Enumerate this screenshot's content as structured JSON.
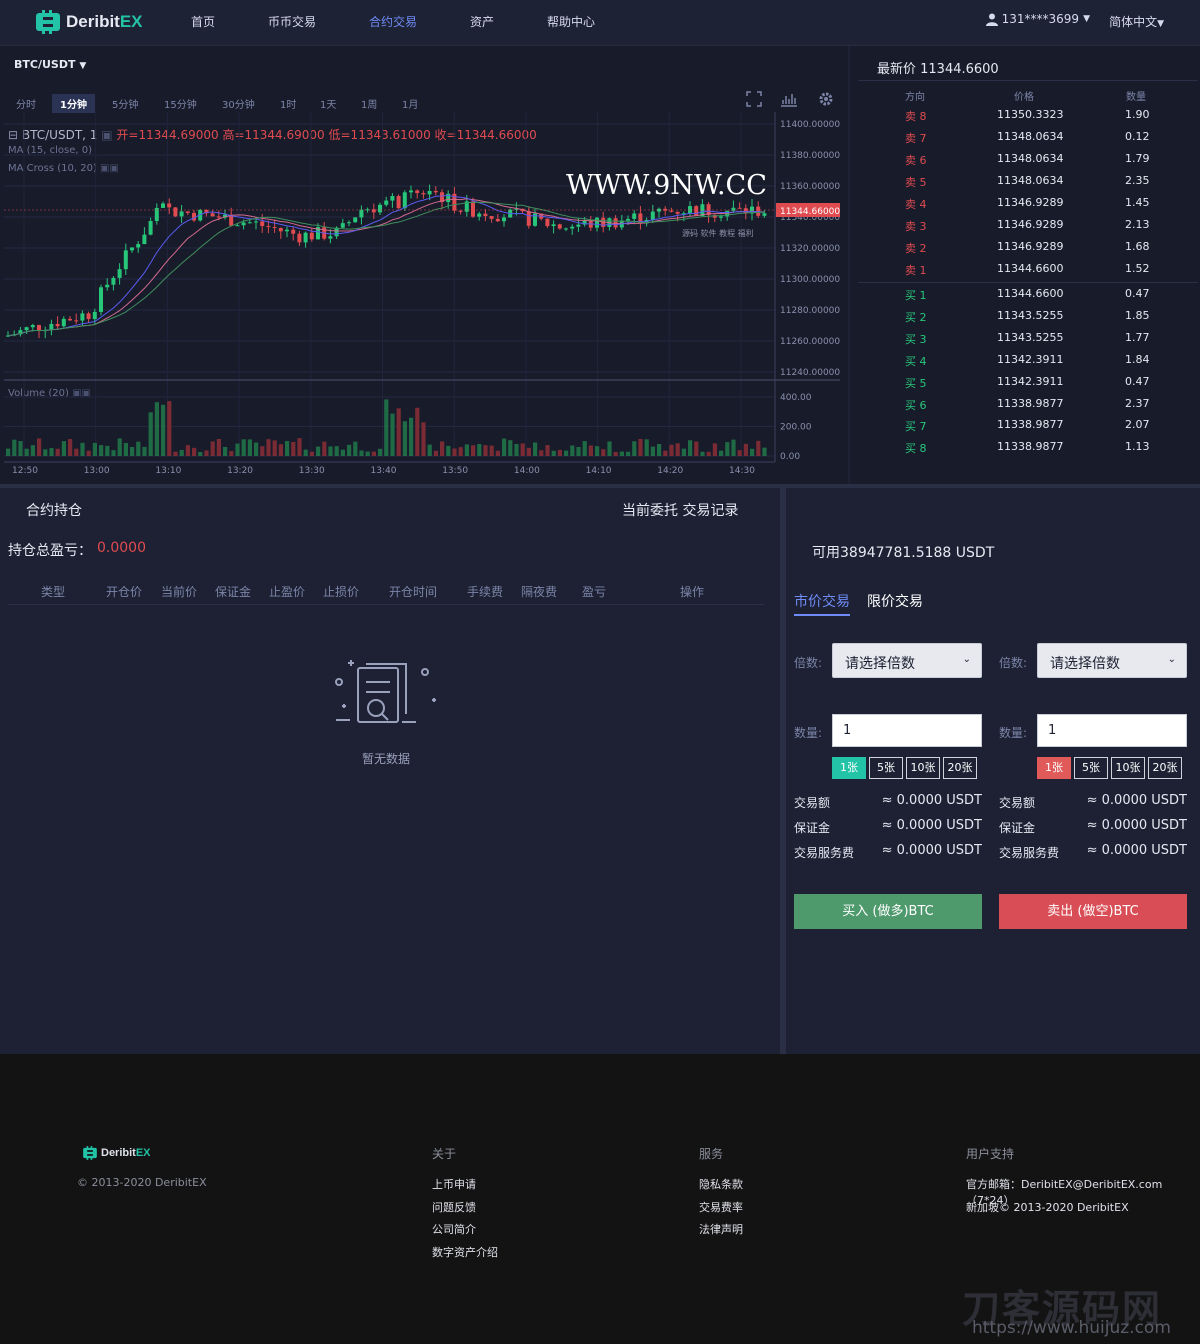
{
  "header": {
    "brand_a": "Deribit",
    "brand_b": "EX",
    "nav": [
      "首页",
      "币币交易",
      "合约交易",
      "资产",
      "帮助中心"
    ],
    "nav_active": 2,
    "user": "131****3699",
    "lang": "简体中文"
  },
  "chart": {
    "pair": "BTC/USDT",
    "timeframes": [
      "分时",
      "1分钟",
      "5分钟",
      "15分钟",
      "30分钟",
      "1时",
      "1天",
      "1周",
      "1月"
    ],
    "timeframe_active": 1,
    "hud_symbol": "BTC/USDT, 1",
    "hud_open": "开=11344.69000",
    "hud_high": "高=11344.69000",
    "hud_low": "低=11343.61000",
    "hud_close": "收=11344.66000",
    "ma_label": "MA (15, close, 0)",
    "macross_label": "MA Cross (10, 20)",
    "volume_label": "Volume (20)",
    "price_ticks": [
      "11400.00000",
      "11380.00000",
      "11360.00000",
      "11340.00000",
      "11320.00000",
      "11300.00000",
      "11280.00000",
      "11260.00000",
      "11240.00000"
    ],
    "last_price_tag": "11344.66000",
    "volume_ticks": [
      "400.00",
      "200.00",
      "0.00"
    ],
    "time_ticks": [
      "12:50",
      "13:00",
      "13:10",
      "13:20",
      "13:30",
      "13:40",
      "13:50",
      "14:00",
      "14:10",
      "14:20",
      "14:30"
    ],
    "watermark": "WWW.9NW.CC",
    "watermark_sub": "源码 软件 教程 福利"
  },
  "book": {
    "title": "最新价 11344.6600",
    "headers": [
      "方向",
      "价格",
      "数量"
    ],
    "asks": [
      {
        "side": "卖 8",
        "price": "11350.3323",
        "qty": "1.90"
      },
      {
        "side": "卖 7",
        "price": "11348.0634",
        "qty": "0.12"
      },
      {
        "side": "卖 6",
        "price": "11348.0634",
        "qty": "1.79"
      },
      {
        "side": "卖 5",
        "price": "11348.0634",
        "qty": "2.35"
      },
      {
        "side": "卖 4",
        "price": "11346.9289",
        "qty": "1.45"
      },
      {
        "side": "卖 3",
        "price": "11346.9289",
        "qty": "2.13"
      },
      {
        "side": "卖 2",
        "price": "11346.9289",
        "qty": "1.68"
      },
      {
        "side": "卖 1",
        "price": "11344.6600",
        "qty": "1.52"
      }
    ],
    "bids": [
      {
        "side": "买 1",
        "price": "11344.6600",
        "qty": "0.47"
      },
      {
        "side": "买 2",
        "price": "11343.5255",
        "qty": "1.85"
      },
      {
        "side": "买 3",
        "price": "11343.5255",
        "qty": "1.77"
      },
      {
        "side": "买 4",
        "price": "11342.3911",
        "qty": "1.84"
      },
      {
        "side": "买 5",
        "price": "11342.3911",
        "qty": "0.47"
      },
      {
        "side": "买 6",
        "price": "11338.9877",
        "qty": "2.37"
      },
      {
        "side": "买 7",
        "price": "11338.9877",
        "qty": "2.07"
      },
      {
        "side": "买 8",
        "price": "11338.9877",
        "qty": "1.13"
      }
    ]
  },
  "positions": {
    "title": "合约持仓",
    "links": "当前委托 交易记录",
    "pnl_label": "持仓总盈亏：",
    "pnl_value": "0.0000",
    "columns": [
      "类型",
      "开仓价",
      "当前价",
      "保证金",
      "止盈价",
      "止损价",
      "开仓时间",
      "手续费",
      "隔夜费",
      "盈亏",
      "操作"
    ],
    "empty": "暂无数据"
  },
  "trade": {
    "available": "可用38947781.5188 USDT",
    "tab_market": "市价交易",
    "tab_limit": "限价交易",
    "leverage_label": "倍数:",
    "leverage_placeholder": "请选择倍数",
    "qty_label": "数量:",
    "qty_value": "1",
    "qty_buttons": [
      "1张",
      "5张",
      "10张",
      "20张"
    ],
    "info_labels": [
      "交易额",
      "保证金",
      "交易服务费"
    ],
    "info_value": "≈ 0.0000 USDT",
    "buy": "买入 (做多)BTC",
    "sell": "卖出 (做空)BTC"
  },
  "footer": {
    "brand_a": "Deribit",
    "brand_b": "EX",
    "copyright": "© 2013-2020 DeribitEX",
    "about_title": "关于",
    "about_links": [
      "上币申请",
      "问题反馈",
      "公司简介",
      "数字资产介绍"
    ],
    "service_title": "服务",
    "service_links": [
      "隐私条款",
      "交易费率",
      "法律声明"
    ],
    "support_title": "用户支持",
    "support_email": "官方邮箱：DeribitEX@DeribitEX.com（7*24）",
    "support_copy": "新加坡© 2013-2020 DeribitEX",
    "wm_big": "刀客源码网",
    "wm_url": "https://www.huijuz.com"
  },
  "colors": {
    "up": "#27c77a",
    "down": "#e04b50",
    "accent": "#6f8cf6",
    "brand": "#22c3a6"
  }
}
